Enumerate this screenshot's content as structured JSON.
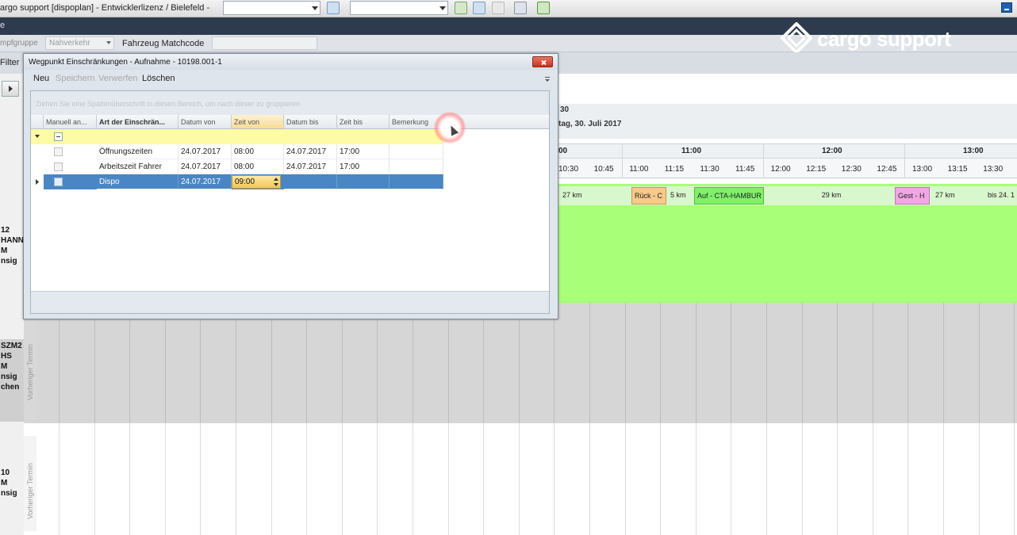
{
  "window": {
    "title": "argo support [dispoplan] - Entwicklerlizenz / Bielefeld -"
  },
  "navband": {
    "label": "e"
  },
  "toolbar2": {
    "group_label": "mpfgruppe",
    "group_value": "Nahverkehr",
    "matchcode_label": "Fahrzeug Matchcode",
    "matchcode_value": ""
  },
  "filter": {
    "label": "Filter"
  },
  "logo": {
    "text": "cargo support"
  },
  "gantt": {
    "header_num": "30",
    "header_date": "tag, 30. Juli 2017",
    "hours": [
      "00",
      "11:00",
      "12:00",
      "13:00"
    ],
    "minutes": [
      "10:30",
      "10:45",
      "11:00",
      "11:15",
      "11:30",
      "11:45",
      "12:00",
      "12:15",
      "12:30",
      "12:45",
      "13:00",
      "13:15",
      "13:30",
      "13"
    ],
    "segments": [
      "27 km",
      "Rück - C",
      "5 km",
      "Auf - CTA-HAMBUR",
      "29 km",
      "Gest - H",
      "27 km",
      "bis 24. 1"
    ],
    "rows": [
      {
        "line1": "12",
        "line2": "HANN",
        "line3": "M",
        "line4": "nsig"
      },
      {
        "line1": "SZM2",
        "line2": "HS",
        "line3": "M",
        "line4": "nsig",
        "line5": "chen",
        "vertical": "Vorheriger Termin"
      },
      {
        "line1": "10",
        "line2": "M",
        "line3": "nsig",
        "vertical": "Vorheriger Termin"
      }
    ]
  },
  "dialog": {
    "title": "Wegpunkt Einschränkungen - Aufnahme - 10198.001-1",
    "menu": {
      "neu": "Neu",
      "speichern": "Speichern",
      "verwerfen": "Verwerfen",
      "loeschen": "Löschen"
    },
    "group_hint": "Ziehen Sie eine Spaltenüberschrift in diesen Bereich, um nach dieser zu gruppieren",
    "columns": [
      "Manuell an...",
      "Art der Einschrän...",
      "Datum von",
      "Zeit von",
      "Datum bis",
      "Zeit bis",
      "Bemerkung"
    ],
    "rows": [
      {
        "art": "Öffnungszeiten",
        "datum_von": "24.07.2017",
        "zeit_von": "08:00",
        "datum_bis": "24.07.2017",
        "zeit_bis": "17:00",
        "bemerkung": ""
      },
      {
        "art": "Arbeitszeit Fahrer",
        "datum_von": "24.07.2017",
        "zeit_von": "08:00",
        "datum_bis": "24.07.2017",
        "zeit_bis": "17:00",
        "bemerkung": ""
      },
      {
        "art": "Dispo",
        "datum_von": "24.07.2017",
        "zeit_von": "09:00",
        "datum_bis": "",
        "zeit_bis": "",
        "bemerkung": ""
      }
    ]
  },
  "colors": {
    "navy": "#2e3b4e",
    "green": "#a8ff78",
    "selection": "#4a86c3",
    "filter_row": "#fdfba3",
    "segment_orange": "#f7c98a",
    "segment_pink": "#f2a7e4"
  }
}
